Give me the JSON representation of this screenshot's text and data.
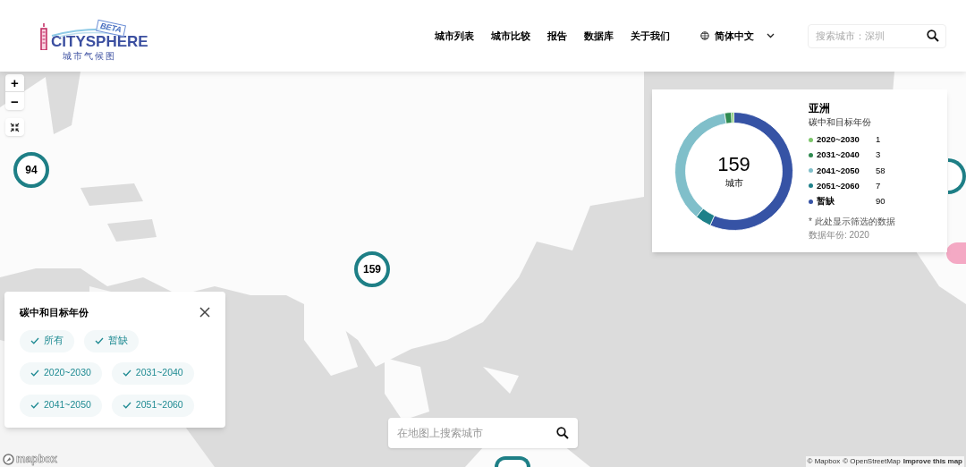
{
  "logo": {
    "name": "CITYSPHERE",
    "badge": "BETA",
    "subtitle": "城市气候图"
  },
  "nav": [
    {
      "label": "城市列表"
    },
    {
      "label": "城市比较"
    },
    {
      "label": "报告"
    },
    {
      "label": "数据库"
    },
    {
      "label": "关于我们"
    }
  ],
  "language": {
    "label": "简体中文"
  },
  "search": {
    "placeholder": "搜索城市：深圳"
  },
  "map": {
    "zoom_controls": [
      {
        "label": "+"
      },
      {
        "label": "−"
      }
    ],
    "clusters": [
      {
        "count": "94"
      },
      {
        "count": "159"
      }
    ],
    "summary": {
      "region": "亚洲",
      "subtitle": "碳中和目标年份",
      "total": "159",
      "total_label": "城市",
      "note": "* 此处显示筛选的数据",
      "data_year": "数据年份: 2020",
      "chart_data": {
        "type": "donut",
        "values": [
          0.63,
          1.89,
          36.48,
          4.4,
          56.6
        ],
        "colors": [
          "#7cc56a",
          "#2f8a50",
          "#80bfca",
          "#1e8089",
          "#3653a5"
        ]
      },
      "legend": [
        {
          "label": "2020~2030",
          "count": "1",
          "color": "#7cc56a"
        },
        {
          "label": "2031~2040",
          "count": "3",
          "color": "#2f8a50"
        },
        {
          "label": "2041~2050",
          "count": "58",
          "color": "#80bfca"
        },
        {
          "label": "2051~2060",
          "count": "7",
          "color": "#1e8089"
        },
        {
          "label": "暂缺",
          "count": "90",
          "color": "#3653a5"
        }
      ]
    },
    "filter": {
      "title": "碳中和目标年份",
      "chips": [
        {
          "label": "所有",
          "checked": true
        },
        {
          "label": "暂缺",
          "checked": true
        },
        {
          "label": "2020~2030",
          "checked": true
        },
        {
          "label": "2031~2040",
          "checked": true
        },
        {
          "label": "2041~2050",
          "checked": true
        },
        {
          "label": "2051~2060",
          "checked": true
        }
      ]
    },
    "map_search": {
      "placeholder": "在地图上搜索城市"
    },
    "logo_mark": "mapbox",
    "attribution": [
      "© Mapbox",
      "© OpenStreetMap"
    ],
    "improve_link": "Improve this map"
  }
}
